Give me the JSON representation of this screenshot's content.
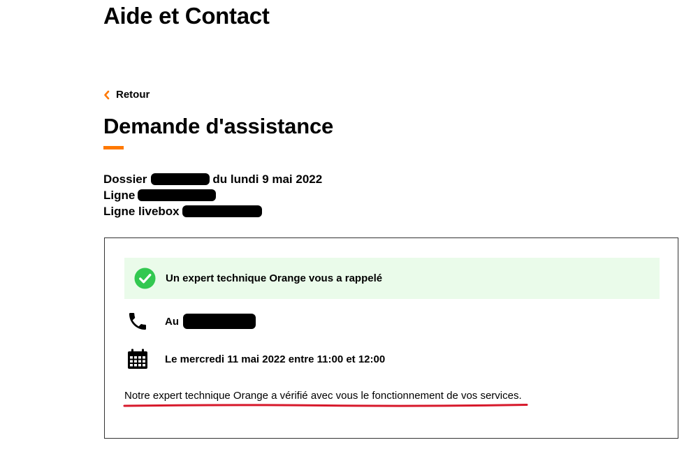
{
  "header": {
    "title": "Aide et Contact"
  },
  "navigation": {
    "back_label": "Retour"
  },
  "page": {
    "heading": "Demande d'assistance"
  },
  "details": {
    "dossier_prefix": "Dossier",
    "dossier_suffix": "du lundi 9 mai 2022",
    "ligne_label": "Ligne",
    "ligne_livebox_label": "Ligne livebox"
  },
  "card": {
    "status_text": "Un expert technique Orange vous a rappelé",
    "phone_label": "Au",
    "appointment_text": "Le mercredi 11 mai 2022 entre 11:00 et 12:00",
    "note_text": "Notre expert technique Orange a vérifié avec vous le fonctionnement de vos services."
  },
  "icons": {
    "back": "chevron-left-icon",
    "status": "check-circle-icon",
    "phone": "phone-icon",
    "calendar": "calendar-icon"
  },
  "colors": {
    "accent": "#ff7900",
    "success_bg": "#eafbea",
    "success_icon": "#32c850",
    "annotation": "#d7192b"
  }
}
